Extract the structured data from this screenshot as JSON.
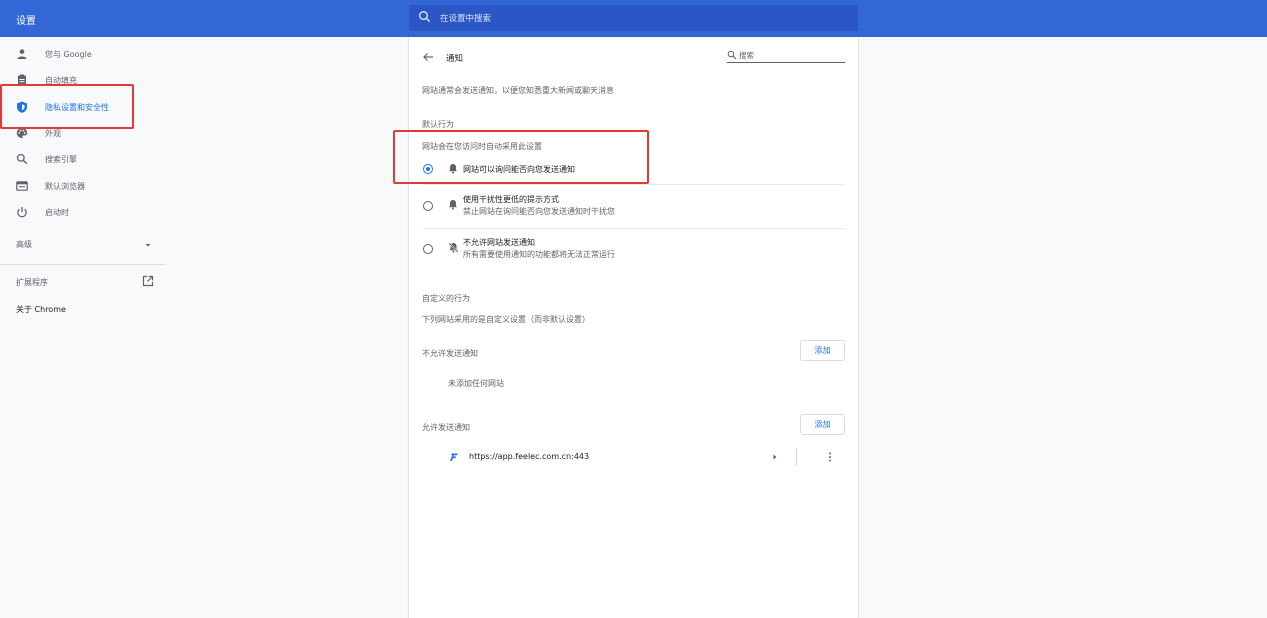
{
  "app": {
    "title": "设置"
  },
  "search": {
    "placeholder": "在设置中搜索"
  },
  "sidebar": {
    "items": [
      {
        "label": "您与 Google",
        "icon": "person-icon"
      },
      {
        "label": "自动填充",
        "icon": "clipboard-icon"
      },
      {
        "label": "隐私设置和安全性",
        "icon": "shield-icon",
        "active": true
      },
      {
        "label": "外观",
        "icon": "palette-icon"
      },
      {
        "label": "搜索引擎",
        "icon": "search-icon"
      },
      {
        "label": "默认浏览器",
        "icon": "browser-icon"
      },
      {
        "label": "启动时",
        "icon": "power-icon"
      }
    ],
    "advanced_label": "高级",
    "extensions_label": "扩展程序",
    "about_label": "关于 Chrome"
  },
  "content": {
    "title": "通知",
    "search_label": "搜索",
    "description": "网站通常会发送通知，以便您知悉重大新闻或聊天消息",
    "default_behavior": "默认行为",
    "default_behavior_sub": "网站会在您访问时自动采用此设置",
    "options": [
      {
        "title": "网站可以询问能否向您发送通知",
        "subtitle": "",
        "checked": true,
        "icon": "bell-icon"
      },
      {
        "title": "使用干扰性更低的提示方式",
        "subtitle": "禁止网站在询问能否向您发送通知时干扰您",
        "checked": false,
        "icon": "bell-icon"
      },
      {
        "title": "不允许网站发送通知",
        "subtitle": "所有需要使用通知的功能都将无法正常运行",
        "checked": false,
        "icon": "bell-off-icon"
      }
    ],
    "custom_behavior": "自定义的行为",
    "custom_behavior_sub": "下列网站采用的是自定义设置（而非默认设置）",
    "blocked": {
      "label": "不允许发送通知",
      "add_label": "添加",
      "empty_text": "未添加任何网站"
    },
    "allowed": {
      "label": "允许发送通知",
      "add_label": "添加",
      "sites": [
        {
          "url": "https://app.feelec.com.cn:443"
        }
      ]
    }
  },
  "colors": {
    "header": "#3367d6",
    "accent": "#1a73e8",
    "highlight": "#e53935"
  }
}
